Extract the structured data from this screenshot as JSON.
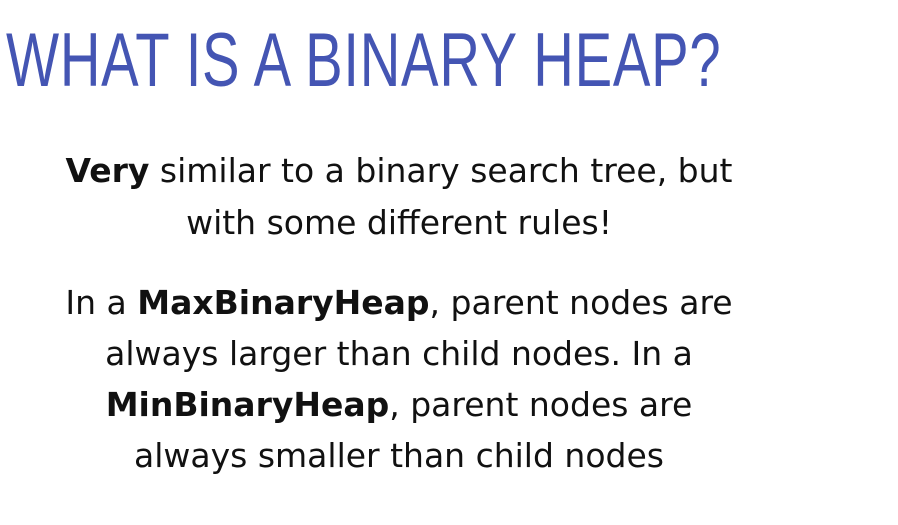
{
  "slide": {
    "title": "WHAT IS A BINARY HEAP?",
    "paragraph1": {
      "line1_bold": "Very",
      "line1_rest": " similar to a binary search tree, but",
      "line2": "with some different rules!"
    },
    "paragraph2": {
      "line1_pre": "In a ",
      "line1_bold": "MaxBinaryHeap",
      "line1_post": ", parent nodes are",
      "line2": "always larger than child nodes. In a",
      "line3_bold": "MinBinaryHeap",
      "line3_post": ", parent nodes are",
      "line4": "always smaller than child nodes"
    },
    "colors": {
      "title": "#4455b3",
      "body_text": "#111111",
      "background": "#ffffff"
    }
  }
}
